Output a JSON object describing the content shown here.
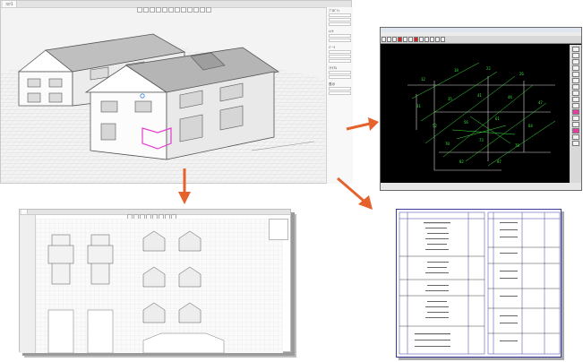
{
  "modeler": {
    "tab_label": "ﾌﾛｱ1",
    "panel_sections": [
      "ﾌﾟﾛﾊﾟﾃｨ",
      "ﾚｲﾔ",
      "ﾊﾟｰﾂ",
      "ﾏﾃﾘｱﾙ",
      "表示"
    ]
  },
  "cad": {
    "title": "",
    "menu": "",
    "status": ""
  },
  "plans": {
    "tab_label": ""
  },
  "colors": {
    "arrow": "#e5622c",
    "cad_lines": "#39e23a",
    "cad_background": "#000000",
    "selection": "#e13fd0",
    "doc_border": "#3a3a9a"
  }
}
